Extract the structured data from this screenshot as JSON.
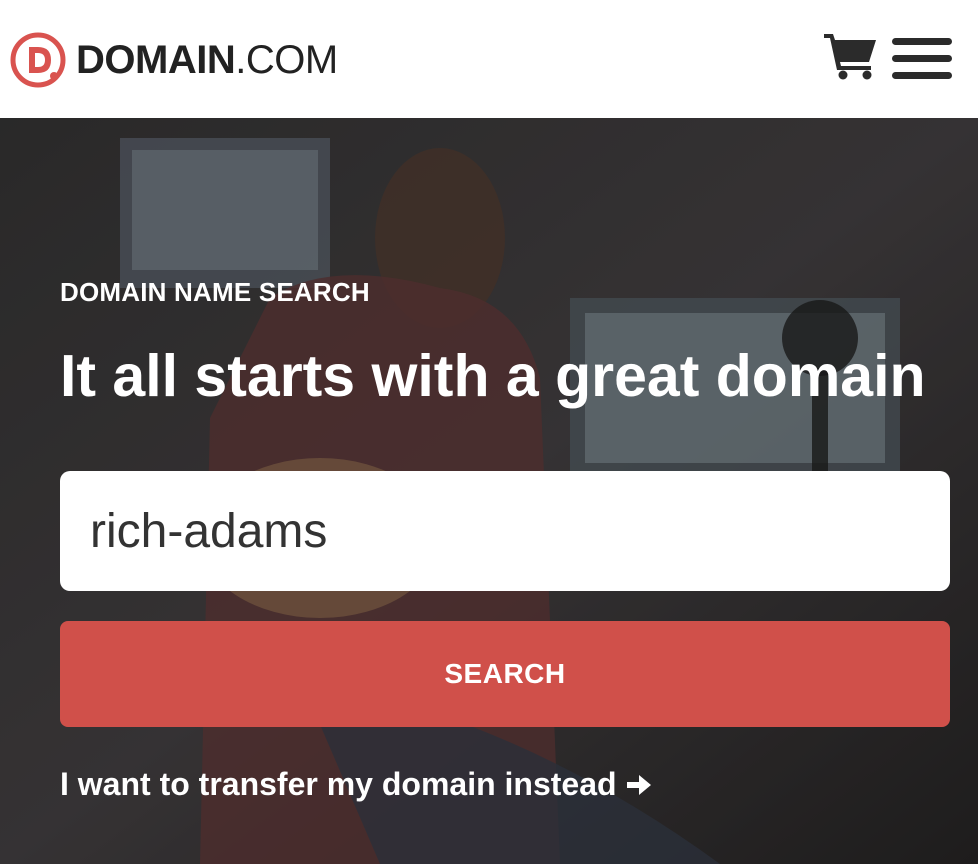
{
  "header": {
    "logo": {
      "mark_letter": "D",
      "brand_bold": "DOMAIN",
      "brand_suffix": ".COM",
      "accent_color": "#d9534f"
    },
    "icons": [
      "cart-icon",
      "hamburger-menu-icon"
    ]
  },
  "hero": {
    "eyebrow": "DOMAIN NAME SEARCH",
    "headline": "It all starts with a great domain",
    "search": {
      "value": "rich-adams",
      "placeholder": ""
    },
    "search_button_label": "SEARCH",
    "transfer_link_label": "I want to transfer my domain instead",
    "transfer_link_icon": "arrow-right-icon",
    "button_color": "#d0504a"
  }
}
